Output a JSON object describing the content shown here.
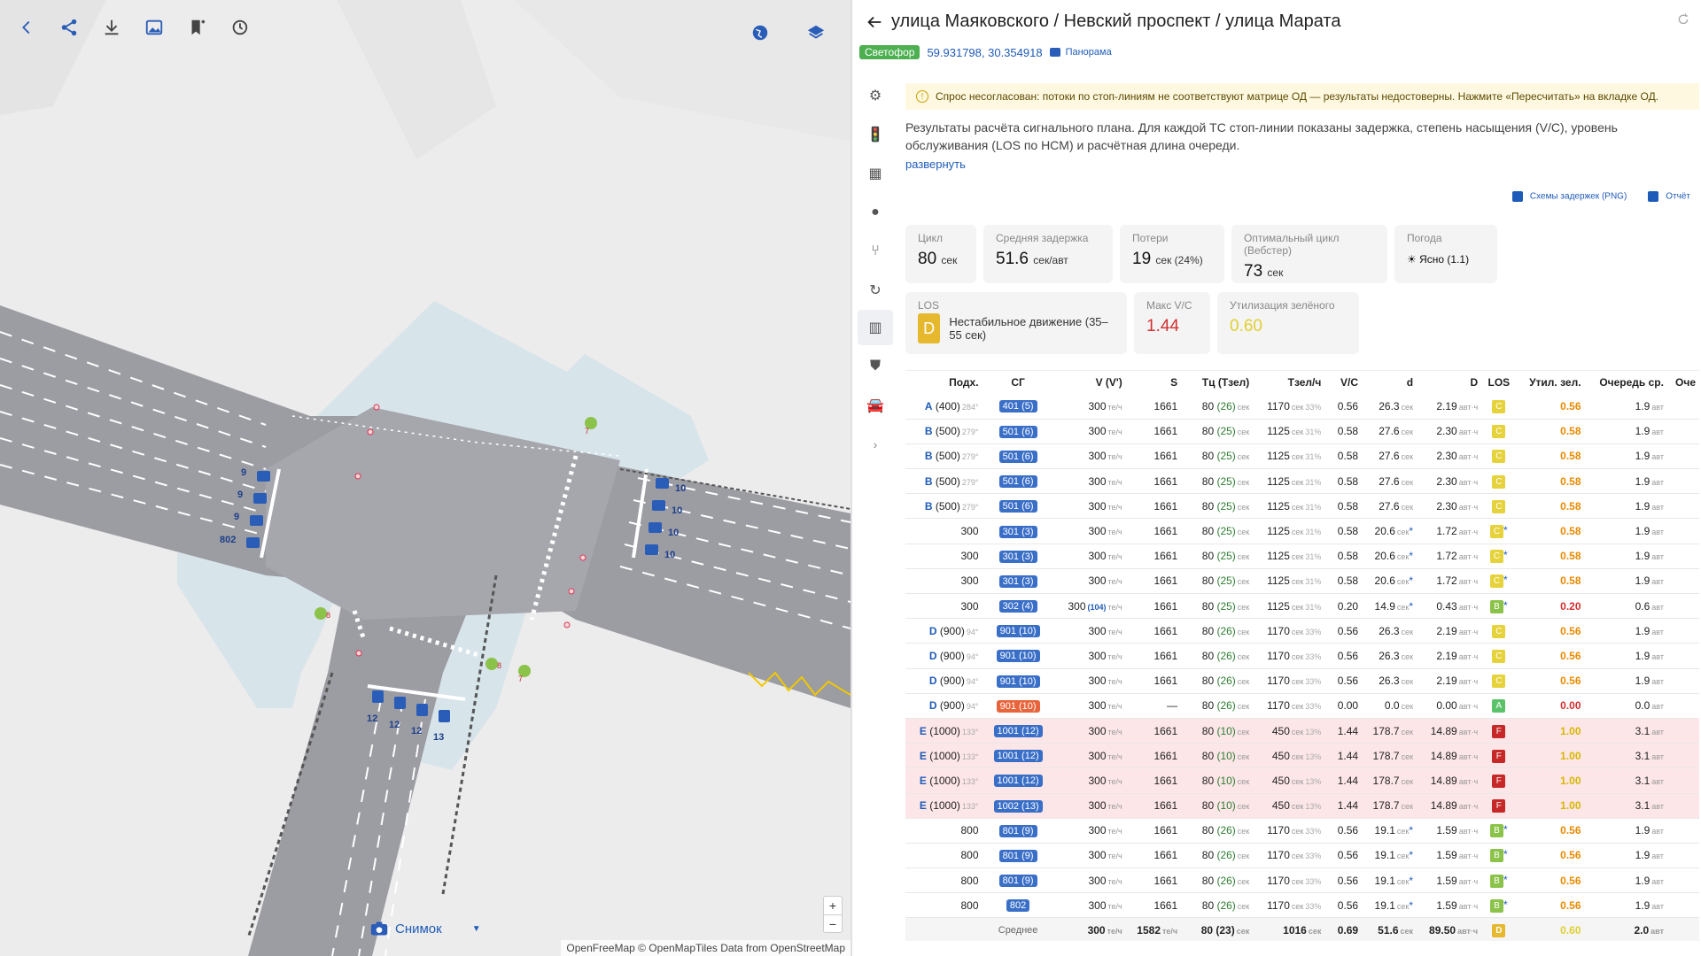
{
  "map": {
    "toolbar": [
      "back-icon",
      "share-icon",
      "download-icon",
      "image-icon",
      "bookmark-add-icon",
      "history-icon"
    ],
    "right_tools": [
      "globe-icon",
      "layers-icon"
    ],
    "lane_counts": [
      "9",
      "9",
      "9",
      "802",
      "10",
      "10",
      "10",
      "10",
      "12",
      "12",
      "12",
      "13",
      "7",
      "8",
      "8",
      "7"
    ],
    "zoom_in": "+",
    "zoom_out": "−",
    "snapshot_label": "Снимок",
    "attribution_a": "OpenFreeMap © OpenMapTiles",
    "attribution_b": "Data from",
    "attribution_c": "OpenStreetMap"
  },
  "panel": {
    "title": "улица Маяковского / Невский проспект / улица Марата",
    "type_badge": "Светофор",
    "coords": "59.931798, 30.354918",
    "panorama": "Панорама",
    "warning": "Спрос несогласован: потоки по стоп-линиям не соответствуют матрице ОД — результаты недостоверны. Нажмите «Пересчитать» на вкладке ОД.",
    "description": "Результаты расчёта сигнального плана. Для каждой ТС стоп-линии показаны задержка, степень насыщения (V/C), уровень обслуживания (LOS по HCM) и расчётная длина очереди.",
    "expand": "развернуть",
    "link_png": "Схемы задержек (PNG)",
    "link_report": "Отчёт",
    "cards": {
      "cycle_label": "Цикл",
      "cycle_value": "80",
      "cycle_unit": "сек",
      "delay_label": "Средняя задержка",
      "delay_value": "51.6",
      "delay_unit": "сек/авт",
      "loss_label": "Потери",
      "loss_value": "19",
      "loss_unit": "сек (24%)",
      "opt_label": "Оптимальный цикл (Вебстер)",
      "opt_value": "73",
      "opt_unit": "сек",
      "weather_label": "Погода",
      "weather_value": "Ясно (1.1)",
      "los_label": "LOS",
      "los_value": "D",
      "los_desc": "Нестабильное движение (35–55 сек)",
      "maxvc_label": "Макс V/C",
      "maxvc_value": "1.44",
      "util_label": "Утилизация зелёного",
      "util_value": "0.60"
    },
    "colors": {
      "los_A": "#5cc26a",
      "los_B": "#8bc34a",
      "los_C": "#e6d23a",
      "los_D": "#e6b82e",
      "los_F": "#c62828",
      "red": "#d32f2f",
      "yellow": "#d7b700",
      "orange": "#e88a00"
    },
    "table": {
      "headers": [
        "Подх.",
        "СГ",
        "V (V')",
        "S",
        "Тц (Тзел)",
        "Тзел/ч",
        "V/C",
        "d",
        "D",
        "LOS",
        "Утил. зел.",
        "Очередь ср.",
        "Оче"
      ],
      "rows": [
        {
          "ap": "A",
          "apn": "(400)",
          "ang": "284°",
          "sg": "401 (5)",
          "v": "300",
          "s": "1661",
          "tc": "80",
          "tg": "(26)",
          "tzh": "1170",
          "tzp": "33%",
          "vc": "0.56",
          "d": "26.3",
          "dstar": "",
          "D": "2.19",
          "los": "C",
          "lstar": "",
          "util": "0.56",
          "q": "1.9"
        },
        {
          "ap": "B",
          "apn": "(500)",
          "ang": "279°",
          "sg": "501 (6)",
          "v": "300",
          "s": "1661",
          "tc": "80",
          "tg": "(25)",
          "tzh": "1125",
          "tzp": "31%",
          "vc": "0.58",
          "d": "27.6",
          "dstar": "",
          "D": "2.30",
          "los": "C",
          "lstar": "",
          "util": "0.58",
          "q": "1.9"
        },
        {
          "ap": "B",
          "apn": "(500)",
          "ang": "279°",
          "sg": "501 (6)",
          "v": "300",
          "s": "1661",
          "tc": "80",
          "tg": "(25)",
          "tzh": "1125",
          "tzp": "31%",
          "vc": "0.58",
          "d": "27.6",
          "dstar": "",
          "D": "2.30",
          "los": "C",
          "lstar": "",
          "util": "0.58",
          "q": "1.9"
        },
        {
          "ap": "B",
          "apn": "(500)",
          "ang": "279°",
          "sg": "501 (6)",
          "v": "300",
          "s": "1661",
          "tc": "80",
          "tg": "(25)",
          "tzh": "1125",
          "tzp": "31%",
          "vc": "0.58",
          "d": "27.6",
          "dstar": "",
          "D": "2.30",
          "los": "C",
          "lstar": "",
          "util": "0.58",
          "q": "1.9"
        },
        {
          "ap": "B",
          "apn": "(500)",
          "ang": "279°",
          "sg": "501 (6)",
          "v": "300",
          "s": "1661",
          "tc": "80",
          "tg": "(25)",
          "tzh": "1125",
          "tzp": "31%",
          "vc": "0.58",
          "d": "27.6",
          "dstar": "",
          "D": "2.30",
          "los": "C",
          "lstar": "",
          "util": "0.58",
          "q": "1.9"
        },
        {
          "ap": "",
          "apn": "300",
          "ang": "",
          "sg": "301 (3)",
          "v": "300",
          "s": "1661",
          "tc": "80",
          "tg": "(25)",
          "tzh": "1125",
          "tzp": "31%",
          "vc": "0.58",
          "d": "20.6",
          "dstar": "*",
          "D": "1.72",
          "los": "C",
          "lstar": "*",
          "util": "0.58",
          "q": "1.9"
        },
        {
          "ap": "",
          "apn": "300",
          "ang": "",
          "sg": "301 (3)",
          "v": "300",
          "s": "1661",
          "tc": "80",
          "tg": "(25)",
          "tzh": "1125",
          "tzp": "31%",
          "vc": "0.58",
          "d": "20.6",
          "dstar": "*",
          "D": "1.72",
          "los": "C",
          "lstar": "*",
          "util": "0.58",
          "q": "1.9"
        },
        {
          "ap": "",
          "apn": "300",
          "ang": "",
          "sg": "301 (3)",
          "v": "300",
          "s": "1661",
          "tc": "80",
          "tg": "(25)",
          "tzh": "1125",
          "tzp": "31%",
          "vc": "0.58",
          "d": "20.6",
          "dstar": "*",
          "D": "1.72",
          "los": "C",
          "lstar": "*",
          "util": "0.58",
          "q": "1.9"
        },
        {
          "ap": "",
          "apn": "300",
          "ang": "",
          "sg": "302 (4)",
          "v": "300",
          "vp": "(104)",
          "s": "1661",
          "tc": "80",
          "tg": "(25)",
          "tzh": "1125",
          "tzp": "31%",
          "vc": "0.20",
          "d": "14.9",
          "dstar": "*",
          "D": "0.43",
          "los": "B",
          "lstar": "*",
          "util": "0.20",
          "q": "0.6"
        },
        {
          "ap": "D",
          "apn": "(900)",
          "ang": "94°",
          "sg": "901 (10)",
          "v": "300",
          "s": "1661",
          "tc": "80",
          "tg": "(26)",
          "tzh": "1170",
          "tzp": "33%",
          "vc": "0.56",
          "d": "26.3",
          "dstar": "",
          "D": "2.19",
          "los": "C",
          "lstar": "",
          "util": "0.56",
          "q": "1.9"
        },
        {
          "ap": "D",
          "apn": "(900)",
          "ang": "94°",
          "sg": "901 (10)",
          "v": "300",
          "s": "1661",
          "tc": "80",
          "tg": "(26)",
          "tzh": "1170",
          "tzp": "33%",
          "vc": "0.56",
          "d": "26.3",
          "dstar": "",
          "D": "2.19",
          "los": "C",
          "lstar": "",
          "util": "0.56",
          "q": "1.9"
        },
        {
          "ap": "D",
          "apn": "(900)",
          "ang": "94°",
          "sg": "901 (10)",
          "v": "300",
          "s": "1661",
          "tc": "80",
          "tg": "(26)",
          "tzh": "1170",
          "tzp": "33%",
          "vc": "0.56",
          "d": "26.3",
          "dstar": "",
          "D": "2.19",
          "los": "C",
          "lstar": "",
          "util": "0.56",
          "q": "1.9"
        },
        {
          "ap": "D",
          "apn": "(900)",
          "ang": "94°",
          "sg": "901 (10)",
          "sgred": true,
          "v": "300",
          "s": "—",
          "tc": "80",
          "tg": "(26)",
          "tzh": "1170",
          "tzp": "33%",
          "vc": "0.00",
          "d": "0.0",
          "dstar": "",
          "D": "0.00",
          "los": "A",
          "lstar": "",
          "util": "0.00",
          "q": "0.0"
        },
        {
          "ap": "E",
          "apn": "(1000)",
          "ang": "133°",
          "sg": "1001 (12)",
          "v": "300",
          "s": "1661",
          "tc": "80",
          "tg": "(10)",
          "tzh": "450",
          "tzp": "13%",
          "vc": "1.44",
          "d": "178.7",
          "dstar": "",
          "D": "14.89",
          "los": "F",
          "lstar": "",
          "util": "1.00",
          "q": "3.1",
          "bad": true
        },
        {
          "ap": "E",
          "apn": "(1000)",
          "ang": "133°",
          "sg": "1001 (12)",
          "v": "300",
          "s": "1661",
          "tc": "80",
          "tg": "(10)",
          "tzh": "450",
          "tzp": "13%",
          "vc": "1.44",
          "d": "178.7",
          "dstar": "",
          "D": "14.89",
          "los": "F",
          "lstar": "",
          "util": "1.00",
          "q": "3.1",
          "bad": true
        },
        {
          "ap": "E",
          "apn": "(1000)",
          "ang": "133°",
          "sg": "1001 (12)",
          "v": "300",
          "s": "1661",
          "tc": "80",
          "tg": "(10)",
          "tzh": "450",
          "tzp": "13%",
          "vc": "1.44",
          "d": "178.7",
          "dstar": "",
          "D": "14.89",
          "los": "F",
          "lstar": "",
          "util": "1.00",
          "q": "3.1",
          "bad": true
        },
        {
          "ap": "E",
          "apn": "(1000)",
          "ang": "133°",
          "sg": "1002 (13)",
          "v": "300",
          "s": "1661",
          "tc": "80",
          "tg": "(10)",
          "tzh": "450",
          "tzp": "13%",
          "vc": "1.44",
          "d": "178.7",
          "dstar": "",
          "D": "14.89",
          "los": "F",
          "lstar": "",
          "util": "1.00",
          "q": "3.1",
          "bad": true
        },
        {
          "ap": "",
          "apn": "800",
          "ang": "",
          "sg": "801 (9)",
          "v": "300",
          "s": "1661",
          "tc": "80",
          "tg": "(26)",
          "tzh": "1170",
          "tzp": "33%",
          "vc": "0.56",
          "d": "19.1",
          "dstar": "*",
          "D": "1.59",
          "los": "B",
          "lstar": "*",
          "util": "0.56",
          "q": "1.9"
        },
        {
          "ap": "",
          "apn": "800",
          "ang": "",
          "sg": "801 (9)",
          "v": "300",
          "s": "1661",
          "tc": "80",
          "tg": "(26)",
          "tzh": "1170",
          "tzp": "33%",
          "vc": "0.56",
          "d": "19.1",
          "dstar": "*",
          "D": "1.59",
          "los": "B",
          "lstar": "*",
          "util": "0.56",
          "q": "1.9"
        },
        {
          "ap": "",
          "apn": "800",
          "ang": "",
          "sg": "801 (9)",
          "v": "300",
          "s": "1661",
          "tc": "80",
          "tg": "(26)",
          "tzh": "1170",
          "tzp": "33%",
          "vc": "0.56",
          "d": "19.1",
          "dstar": "*",
          "D": "1.59",
          "los": "B",
          "lstar": "*",
          "util": "0.56",
          "q": "1.9"
        },
        {
          "ap": "",
          "apn": "800",
          "ang": "",
          "sg": "802",
          "v": "300",
          "s": "1661",
          "tc": "80",
          "tg": "(26)",
          "tzh": "1170",
          "tzp": "33%",
          "vc": "0.56",
          "d": "19.1",
          "dstar": "*",
          "D": "1.59",
          "los": "B",
          "lstar": "*",
          "util": "0.56",
          "q": "1.9"
        }
      ],
      "avg": {
        "label": "Среднее",
        "v": "300",
        "s": "1582",
        "tc": "80",
        "tg": "(23)",
        "tzh": "1016",
        "vc": "0.69",
        "d": "51.6",
        "D": "89.50",
        "los": "D",
        "util": "0.60",
        "q": "2.0"
      },
      "units": {
        "v": "те/ч",
        "tc": "сек",
        "tzh": "сек",
        "d": "сек",
        "D": "авт·ч",
        "q": "авт"
      }
    }
  }
}
